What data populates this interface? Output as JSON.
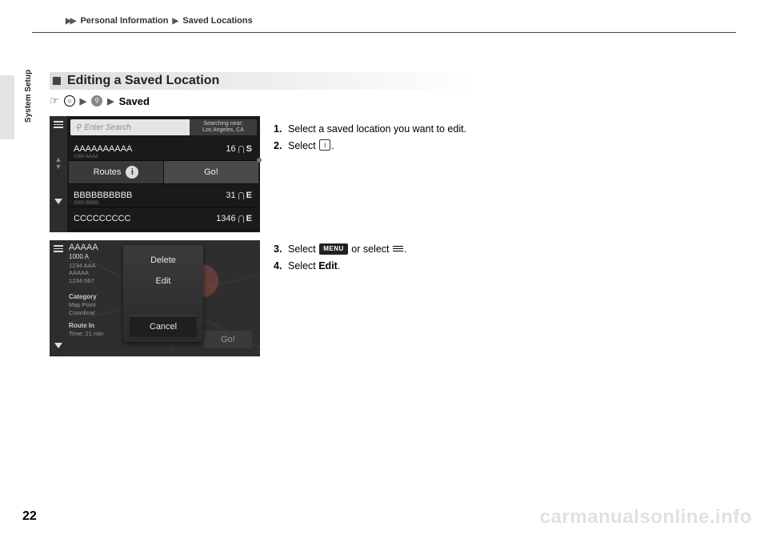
{
  "breadcrumb": {
    "a": "Personal Information",
    "b": "Saved Locations"
  },
  "side_label": "System Setup",
  "page_number": "22",
  "watermark": "carmanualsonline.info",
  "section_title": "Editing a Saved Location",
  "path_saved": "Saved",
  "steps1": [
    {
      "n": "1.",
      "t": "Select a saved location you want to edit."
    },
    {
      "n": "2.",
      "t_pre": "Select ",
      "icon": "info-square",
      "t_post": "."
    }
  ],
  "steps2": [
    {
      "n": "3.",
      "t_pre": "Select ",
      "btn": "MENU",
      "t_mid": " or select ",
      "icon2": "hamburger",
      "t_post": "."
    },
    {
      "n": "4.",
      "t_pre": "Select ",
      "bold": "Edit",
      "t_post": "."
    }
  ],
  "shot1": {
    "search_placeholder": "Enter Search",
    "near_label": "Searching near:",
    "near_value": "Los Angeles, CA",
    "rows": [
      {
        "name": "AAAAAAAAAA",
        "sub": "1000 AAAA",
        "dist": "16",
        "dir": "S"
      },
      {
        "name": "BBBBBBBBBB",
        "sub": "2000 BBBB",
        "dist": "31",
        "dir": "E"
      },
      {
        "name": "CCCCCCCCC",
        "sub": "",
        "dist": "1346",
        "dir": "E"
      }
    ],
    "routes_label": "Routes",
    "go_label": "Go!"
  },
  "shot2": {
    "left": {
      "name": "AAAAA",
      "addr1": "1000 A",
      "addr2": "1234 AAA",
      "addr3": "AAAAA",
      "phone": "1234-567",
      "cat": "Category",
      "mappoint": "Map Point",
      "coord": "Coordinat",
      "route": "Route In",
      "time": "Time: 21 min"
    },
    "go": "Go!",
    "popup": {
      "delete": "Delete",
      "edit": "Edit",
      "cancel": "Cancel"
    }
  }
}
